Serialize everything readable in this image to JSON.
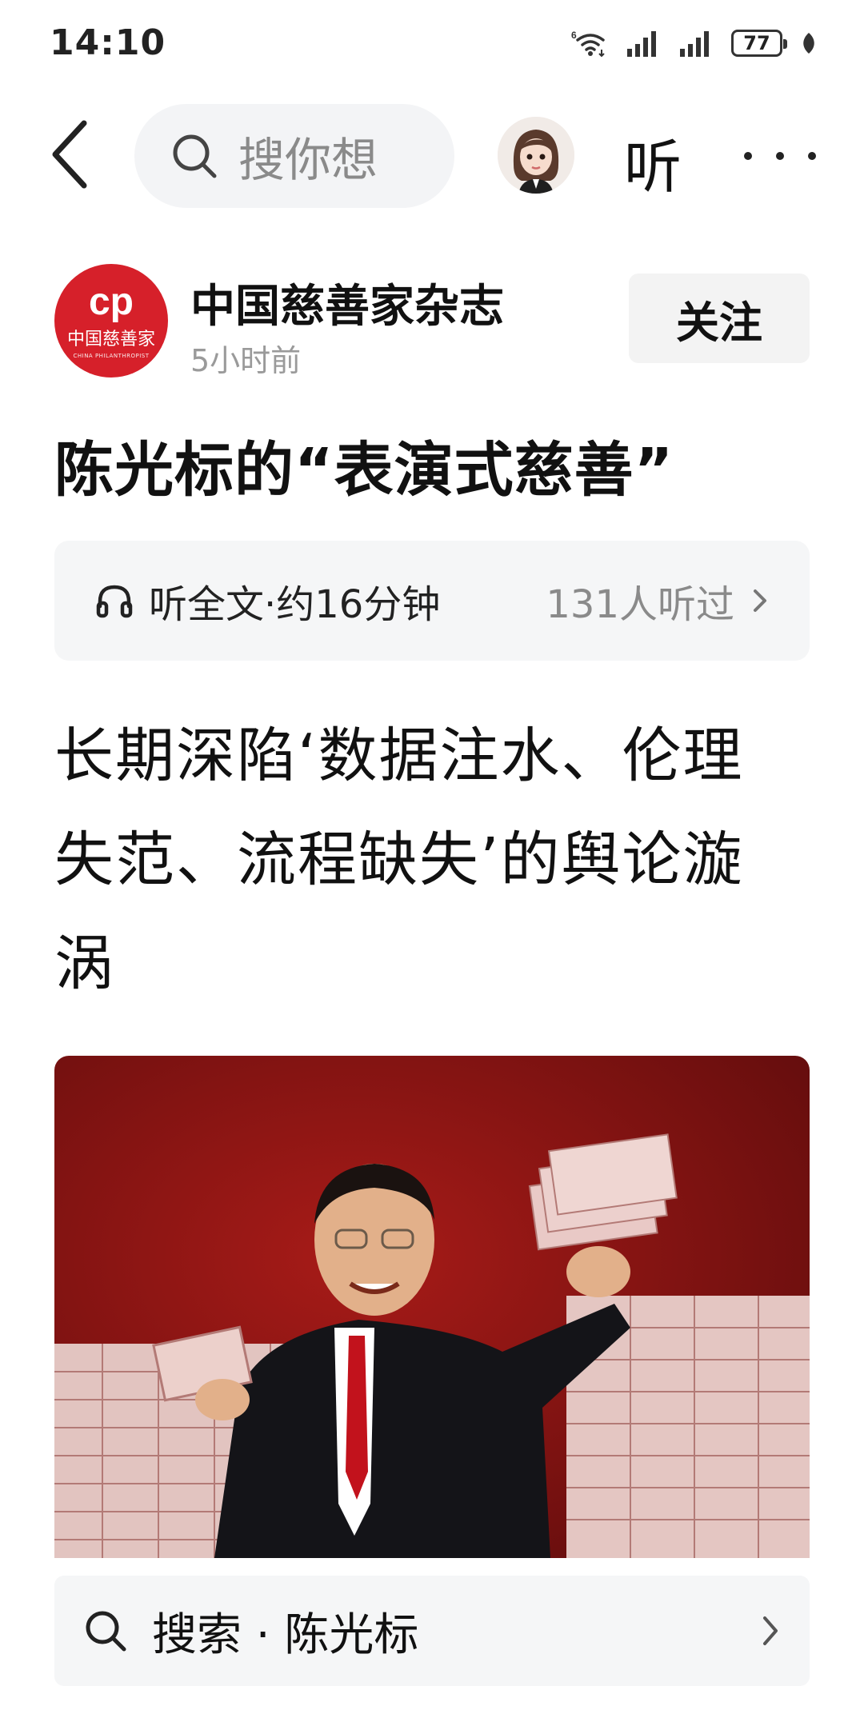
{
  "status_bar": {
    "time": "14:10",
    "network_label": "6",
    "battery": "77"
  },
  "nav": {
    "search_placeholder": "搜你想",
    "listen_label": "听"
  },
  "author": {
    "logo_cp": "cp",
    "logo_cn": "中国慈善家",
    "logo_en": "CHINA PHILANTHROPIST",
    "name": "中国慈善家杂志",
    "time": "5小时前",
    "follow_label": "关注"
  },
  "article": {
    "title": "陈光标的“表演式慈善”",
    "subtitle_lines": [
      "长期深陷‘数据注水、伦理",
      "失范、流程缺失’的舆论漩",
      "涡"
    ]
  },
  "listen_bar": {
    "text": "听全文·约16分钟",
    "count": "131人听过"
  },
  "bottom_search": {
    "text": "搜索 · 陈光标"
  },
  "colors": {
    "brand_red": "#d6202a",
    "photo_background": "#8c1414"
  },
  "icons": [
    "wifi-icon",
    "signal-icon",
    "battery-icon",
    "leaf-icon",
    "back-icon",
    "search-icon",
    "headphones-icon",
    "chevron-right-icon",
    "more-icon"
  ]
}
